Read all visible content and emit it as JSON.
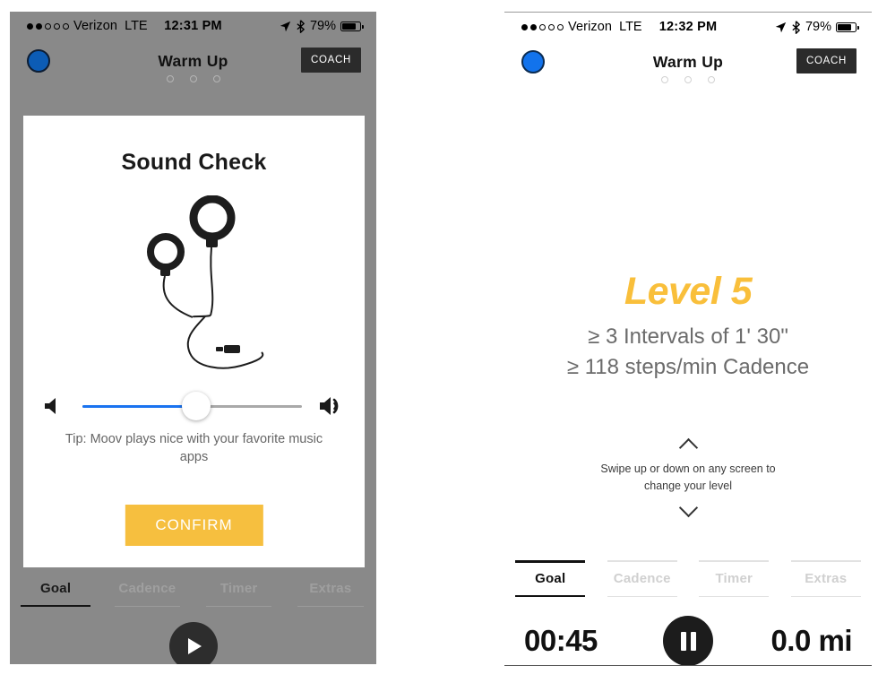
{
  "left_phone": {
    "status_bar": {
      "signal_dots_filled": 2,
      "signal_dots_total": 5,
      "carrier": "Verizon",
      "network": "LTE",
      "time": "12:31 PM",
      "battery_percent": "79%",
      "location_icon": "location-arrow-icon",
      "bluetooth_icon": "bluetooth-icon",
      "battery_icon": "battery-icon"
    },
    "nav": {
      "title": "Warm Up",
      "coach_label": "COACH",
      "status_dot": "blue-status-dot",
      "pager_dots": 3
    },
    "modal": {
      "title": "Sound Check",
      "illustration": "earbuds-illustration",
      "volume_low_icon": "volume-mute-icon",
      "volume_high_icon": "volume-up-icon",
      "volume_value": 52,
      "tip": "Tip: Moov plays nice with your favorite music apps",
      "confirm_label": "CONFIRM"
    },
    "tabs": [
      {
        "label": "Goal",
        "active": true
      },
      {
        "label": "Cadence",
        "active": false
      },
      {
        "label": "Timer",
        "active": false
      },
      {
        "label": "Extras",
        "active": false
      }
    ],
    "play_button": "play-button"
  },
  "right_phone": {
    "status_bar": {
      "signal_dots_filled": 2,
      "signal_dots_total": 5,
      "carrier": "Verizon",
      "network": "LTE",
      "time": "12:32 PM",
      "battery_percent": "79%",
      "location_icon": "location-arrow-icon",
      "bluetooth_icon": "bluetooth-icon",
      "battery_icon": "battery-icon"
    },
    "nav": {
      "title": "Warm Up",
      "coach_label": "COACH",
      "status_dot": "blue-status-dot",
      "pager_dots": 3
    },
    "level": {
      "title": "Level 5",
      "line1": "≥ 3 Intervals of 1' 30\"",
      "line2": "≥ 118 steps/min Cadence",
      "swipe_hint_line1": "Swipe up or down on any screen to",
      "swipe_hint_line2": "change your level",
      "chevron_up": "chevron-up-icon",
      "chevron_down": "chevron-down-icon"
    },
    "tabs": [
      {
        "label": "Goal",
        "active": true
      },
      {
        "label": "Cadence",
        "active": false
      },
      {
        "label": "Timer",
        "active": false
      },
      {
        "label": "Extras",
        "active": false
      }
    ],
    "stats": {
      "elapsed": "00:45",
      "distance": "0.0 mi",
      "pause_button": "pause-button"
    }
  },
  "colors": {
    "accent_yellow": "#f9bf3b",
    "slider_blue": "#1a73f0",
    "status_dot_blue": "#1273ec",
    "overlay_gray": "#898989"
  }
}
